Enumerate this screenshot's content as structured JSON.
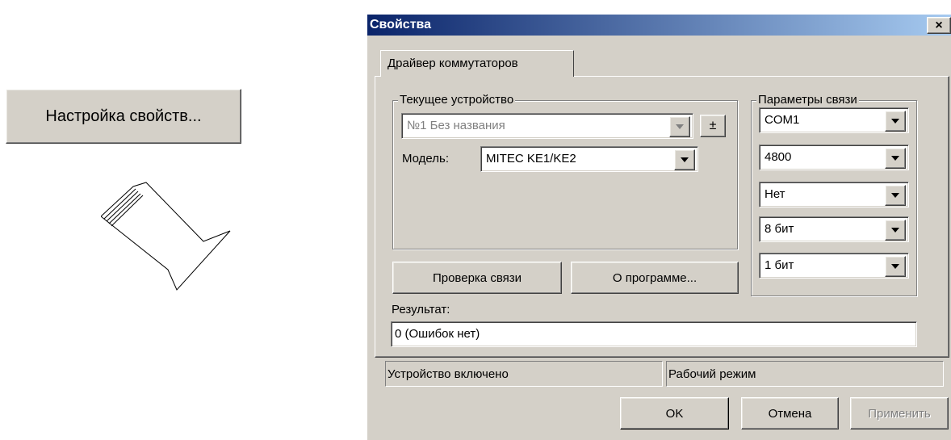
{
  "launcher": {
    "label": "Настройка свойств..."
  },
  "dialog": {
    "title": "Свойства",
    "close_label": "×",
    "tab": "Драйвер коммутаторов",
    "device_group": {
      "legend": "Текущее устройство",
      "device_value": "№1 Без названия",
      "plusminus_label": "±",
      "model_label": "Модель:",
      "model_value": "MITEC KE1/KE2"
    },
    "comm_group": {
      "legend": "Параметры связи",
      "port": "COM1",
      "baud": "4800",
      "parity": "Нет",
      "data_bits": "8 бит",
      "stop_bits": "1 бит"
    },
    "buttons": {
      "check": "Проверка связи",
      "about": "О программе...",
      "ok": "OK",
      "cancel": "Отмена",
      "apply": "Применить"
    },
    "result": {
      "label": "Результат:",
      "value": "0 (Ошибок нет)"
    },
    "status": {
      "device": "Устройство включено",
      "mode": "Рабочий режим"
    }
  },
  "icons": [
    "dropdown-arrow-icon",
    "arrow-icon",
    "close-icon"
  ]
}
